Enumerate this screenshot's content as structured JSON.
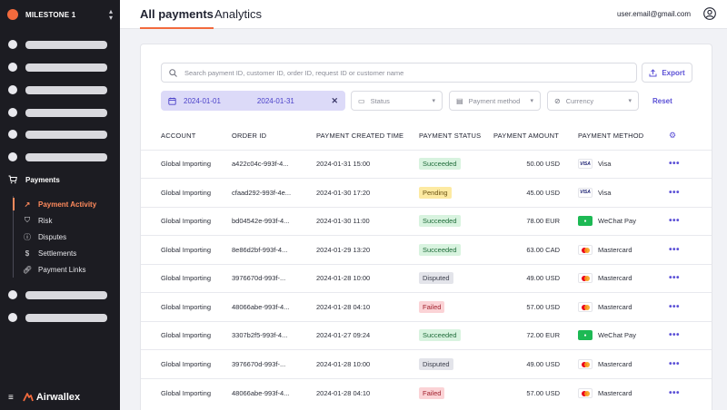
{
  "workspace": {
    "name": "MILESTONE 1",
    "chevron_icon": "chevron-updown-icon"
  },
  "sidebar": {
    "section_label": "Payments",
    "section_icon": "cart-icon",
    "items": [
      {
        "label": "Payment Activity",
        "icon": "trend-icon",
        "active": true
      },
      {
        "label": "Risk",
        "icon": "shield-icon",
        "active": false
      },
      {
        "label": "Disputes",
        "icon": "info-circle-icon",
        "active": false
      },
      {
        "label": "Settlements",
        "icon": "dollar-circle-icon",
        "active": false
      },
      {
        "label": "Payment Links",
        "icon": "link-icon",
        "active": false
      }
    ],
    "footer_brand": "Airwallex"
  },
  "header": {
    "tabs": [
      {
        "label": "All payments",
        "active": true
      },
      {
        "label": "Analytics",
        "active": false
      }
    ],
    "user_email": "user.email@gmail.com"
  },
  "toolbar": {
    "search_placeholder": "Search payment ID, customer ID, order ID, request ID or customer name",
    "export_label": "Export",
    "date_from": "2024-01-01",
    "date_to": "2024-01-31",
    "status_placeholder": "Status",
    "method_placeholder": "Payment method",
    "currency_placeholder": "Currency",
    "reset_label": "Reset"
  },
  "table": {
    "columns": [
      "ACCOUNT",
      "ORDER ID",
      "PAYMENT CREATED TIME",
      "PAYMENT STATUS",
      "PAYMENT AMOUNT",
      "PAYMENT METHOD"
    ],
    "rows": [
      {
        "account": "Global Importing",
        "order_id": "a422c04c-993f-4...",
        "time": "2024-01-31 15:00",
        "status": "Succeeded",
        "amount": "50.00 USD",
        "method": "Visa"
      },
      {
        "account": "Global Importing",
        "order_id": "cfaad292-993f-4e...",
        "time": "2024-01-30 17:20",
        "status": "Pending",
        "amount": "45.00 USD",
        "method": "Visa"
      },
      {
        "account": "Global Importing",
        "order_id": "bd04542e-993f-4...",
        "time": "2024-01-30 11:00",
        "status": "Succeeded",
        "amount": "78.00 EUR",
        "method": "WeChat Pay"
      },
      {
        "account": "Global Importing",
        "order_id": "8e86d2bf-993f-4...",
        "time": "2024-01-29 13:20",
        "status": "Succeeded",
        "amount": "63.00 CAD",
        "method": "Mastercard"
      },
      {
        "account": "Global Importing",
        "order_id": "3976670d-993f-...",
        "time": "2024-01-28 10:00",
        "status": "Disputed",
        "amount": "49.00 USD",
        "method": "Mastercard"
      },
      {
        "account": "Global Importing",
        "order_id": "48066abe-993f-4...",
        "time": "2024-01-28 04:10",
        "status": "Failed",
        "amount": "57.00 USD",
        "method": "Mastercard"
      },
      {
        "account": "Global Importing",
        "order_id": "3307b2f5-993f-4...",
        "time": "2024-01-27 09:24",
        "status": "Succeeded",
        "amount": "72.00 EUR",
        "method": "WeChat Pay"
      },
      {
        "account": "Global Importing",
        "order_id": "3976670d-993f-...",
        "time": "2024-01-28 10:00",
        "status": "Disputed",
        "amount": "49.00 USD",
        "method": "Mastercard"
      },
      {
        "account": "Global Importing",
        "order_id": "48066abe-993f-4...",
        "time": "2024-01-28 04:10",
        "status": "Failed",
        "amount": "57.00 USD",
        "method": "Mastercard"
      }
    ]
  },
  "colors": {
    "accent": "#f26a3d",
    "primary": "#5b50d6",
    "sidebar_bg": "#1c1c22"
  }
}
